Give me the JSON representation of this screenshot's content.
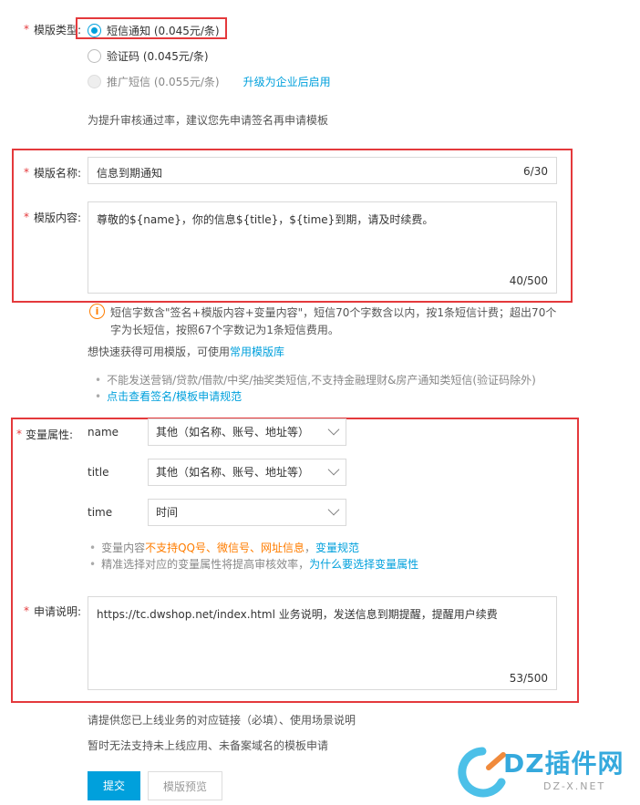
{
  "template_type": {
    "label": "模版类型:",
    "options": [
      {
        "label": "短信通知 (0.045元/条)",
        "state": "checked"
      },
      {
        "label": "验证码 (0.045元/条)",
        "state": "unchecked"
      },
      {
        "label": "推广短信 (0.055元/条)",
        "state": "disabled"
      }
    ],
    "upgrade_link": "升级为企业后启用",
    "hint": "为提升审核通过率，建议您先申请签名再申请模板"
  },
  "template_name": {
    "label": "模版名称:",
    "value": "信息到期通知",
    "counter": "6/30"
  },
  "template_content": {
    "label": "模版内容:",
    "value": "尊敬的${name}，你的信息${title}，${time}到期，请及时续费。",
    "counter": "40/500"
  },
  "content_info": {
    "line1": "短信字数含\"签名+模版内容+变量内容\"，短信70个字数含以内，按1条短信计费；超出70个",
    "line2": "字为长短信，按照67个字数记为1条短信费用。",
    "quick_text": "想快速获得可用模版，可使用",
    "quick_link": "常用模版库",
    "bullet1": "不能发送营销/贷款/借款/中奖/抽奖类短信,不支持金融理财&房产通知类短信(验证码除外)",
    "bullet2_link": "点击查看签名/模板申请规范"
  },
  "variables": {
    "label": "变量属性:",
    "rows": [
      {
        "name": "name",
        "value": "其他（如名称、账号、地址等）"
      },
      {
        "name": "title",
        "value": "其他（如名称、账号、地址等）"
      },
      {
        "name": "time",
        "value": "时间"
      }
    ],
    "note1_prefix": "变量内容",
    "note1_warn": "不支持QQ号、微信号、网址信息",
    "note1_sep": "，",
    "note1_link": "变量规范",
    "note2_text": "精准选择对应的变量属性将提高审核效率，",
    "note2_link": "为什么要选择变量属性"
  },
  "application": {
    "label": "申请说明:",
    "value": "https://tc.dwshop.net/index.html 业务说明，发送信息到期提醒，提醒用户续费",
    "counter": "53/500",
    "hint1": "请提供您已上线业务的对应链接（必填）、使用场景说明",
    "hint2": "暂时无法支持未上线应用、未备案域名的模板申请"
  },
  "buttons": {
    "submit": "提交",
    "preview": "模版预览"
  },
  "watermark": {
    "brand": "DZ插件网",
    "sub": "DZ-X.NET"
  },
  "colors": {
    "accent": "#00a0dc",
    "required": "#e4393c",
    "warning": "#ff7d00"
  }
}
